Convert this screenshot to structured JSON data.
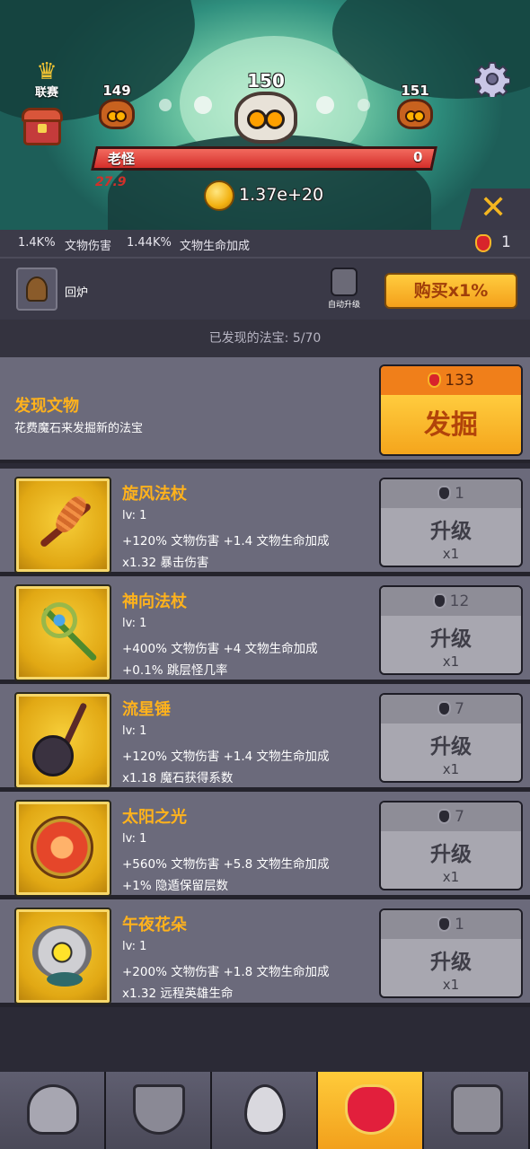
{
  "header": {
    "league_label": "联赛",
    "stage_prev": "149",
    "stage_current": "150",
    "stage_next": "151"
  },
  "boss": {
    "name": "老怪",
    "hp_value": "0",
    "damage_text": "27.9",
    "hp_fill_fraction": 1.0
  },
  "gold": "1.37e+20",
  "stats": {
    "damage_value": "1.4K%",
    "damage_label": "文物伤害",
    "life_value": "1.44K%",
    "life_label": "文物生命加成",
    "gem_count": "1"
  },
  "furnace": {
    "label": "回炉",
    "auto_upgrade_label": "自动升级",
    "buy_label": "购买x1%"
  },
  "discovered_text": "已发现的法宝: 5/70",
  "discover": {
    "title": "发现文物",
    "subtitle": "花费魔石来发掘新的法宝",
    "cost": "133",
    "button_label": "发掘"
  },
  "relics": [
    {
      "name": "旋风法杖",
      "level": "lv: 1",
      "line1": "+120% 文物伤害 +1.4 文物生命加成",
      "line2": "x1.32 暴击伤害",
      "cost": "1",
      "button_label": "升级",
      "multiplier": "x1"
    },
    {
      "name": "神向法杖",
      "level": "lv: 1",
      "line1": "+400% 文物伤害 +4 文物生命加成",
      "line2": "+0.1% 跳层怪几率",
      "cost": "12",
      "button_label": "升级",
      "multiplier": "x1"
    },
    {
      "name": "流星锤",
      "level": "lv: 1",
      "line1": "+120% 文物伤害 +1.4 文物生命加成",
      "line2": "x1.18 魔石获得系数",
      "cost": "7",
      "button_label": "升级",
      "multiplier": "x1"
    },
    {
      "name": "太阳之光",
      "level": "lv: 1",
      "line1": "+560% 文物伤害 +5.8 文物生命加成",
      "line2": "+1% 隐遁保留层数",
      "cost": "7",
      "button_label": "升级",
      "multiplier": "x1"
    },
    {
      "name": "午夜花朵",
      "level": "lv: 1",
      "line1": "+200% 文物伤害 +1.8 文物生命加成",
      "line2": "x1.32 远程英雄生命",
      "cost": "1",
      "button_label": "升级",
      "multiplier": "x1"
    }
  ],
  "nav": {
    "tabs": [
      "helmet-icon",
      "shield-icon",
      "egg-icon",
      "ruby-icon",
      "treasure-chest-icon"
    ],
    "active_index": 3
  },
  "colors": {
    "accent_orange": "#ffb21c",
    "button_gold": "#f4a01b",
    "hp_red": "#e8443a",
    "panel": "#6b6a7b"
  }
}
